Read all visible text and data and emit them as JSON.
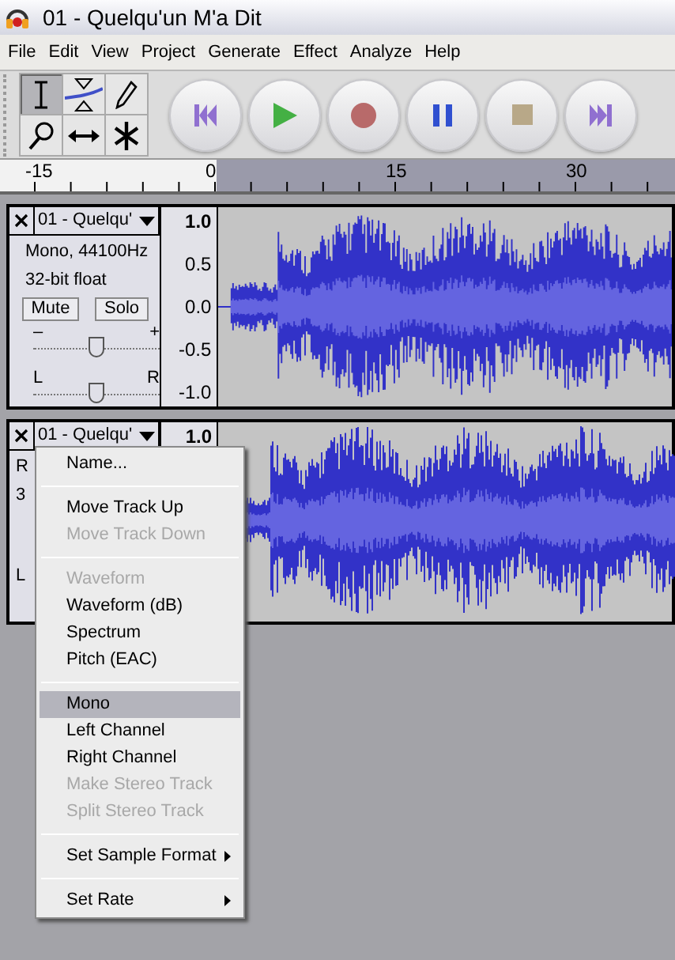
{
  "window": {
    "title": "01 - Quelqu'un M'a Dit"
  },
  "menu_bar": [
    {
      "label": "File"
    },
    {
      "label": "Edit"
    },
    {
      "label": "View"
    },
    {
      "label": "Project"
    },
    {
      "label": "Generate"
    },
    {
      "label": "Effect"
    },
    {
      "label": "Analyze"
    },
    {
      "label": "Help"
    }
  ],
  "tools": [
    {
      "kind": "select",
      "selected": true
    },
    {
      "kind": "envelope",
      "selected": false
    },
    {
      "kind": "draw",
      "selected": false
    },
    {
      "kind": "zoom",
      "selected": false
    },
    {
      "kind": "timeshift",
      "selected": false
    },
    {
      "kind": "multi",
      "selected": false
    }
  ],
  "transport": [
    {
      "kind": "rewind"
    },
    {
      "kind": "play"
    },
    {
      "kind": "record"
    },
    {
      "kind": "pause"
    },
    {
      "kind": "stop"
    },
    {
      "kind": "forward"
    }
  ],
  "ruler": {
    "ticks": [
      "-15",
      "0",
      "15",
      "30"
    ]
  },
  "tracks": [
    {
      "name": "01 - Quelqu'",
      "info": "Mono, 44100Hz",
      "format": "32-bit float",
      "mute": "Mute",
      "solo": "Solo",
      "gain_min": "–",
      "gain_max": "+",
      "gain": {
        "level": 0.5
      },
      "pan_left": "L",
      "pan_right": "R",
      "pan": {
        "level": 0.5
      },
      "scale": [
        "1.0",
        "0.5",
        "0.0",
        "-0.5",
        "-1.0"
      ]
    },
    {
      "name": "01 - Quelqu'",
      "info": "R",
      "format": "3",
      "pan_left": "L",
      "scale": [
        "1.0"
      ]
    }
  ],
  "context_menu": {
    "groups": [
      [
        {
          "label": "Name...",
          "disabled": false,
          "selected": false,
          "submenu": false
        }
      ],
      [
        {
          "label": "Move Track Up",
          "disabled": false,
          "selected": false,
          "submenu": false
        },
        {
          "label": "Move Track Down",
          "disabled": true,
          "selected": false,
          "submenu": false
        }
      ],
      [
        {
          "label": "Waveform",
          "disabled": true,
          "selected": false,
          "submenu": false
        },
        {
          "label": "Waveform (dB)",
          "disabled": false,
          "selected": false,
          "submenu": false
        },
        {
          "label": "Spectrum",
          "disabled": false,
          "selected": false,
          "submenu": false
        },
        {
          "label": "Pitch (EAC)",
          "disabled": false,
          "selected": false,
          "submenu": false
        }
      ],
      [
        {
          "label": "Mono",
          "disabled": false,
          "selected": true,
          "submenu": false
        },
        {
          "label": "Left Channel",
          "disabled": false,
          "selected": false,
          "submenu": false
        },
        {
          "label": "Right Channel",
          "disabled": false,
          "selected": false,
          "submenu": false
        },
        {
          "label": "Make Stereo Track",
          "disabled": true,
          "selected": false,
          "submenu": false
        },
        {
          "label": "Split Stereo Track",
          "disabled": true,
          "selected": false,
          "submenu": false
        }
      ],
      [
        {
          "label": "Set Sample Format",
          "disabled": false,
          "selected": false,
          "submenu": true
        }
      ],
      [
        {
          "label": "Set Rate",
          "disabled": false,
          "selected": false,
          "submenu": true
        }
      ]
    ]
  }
}
